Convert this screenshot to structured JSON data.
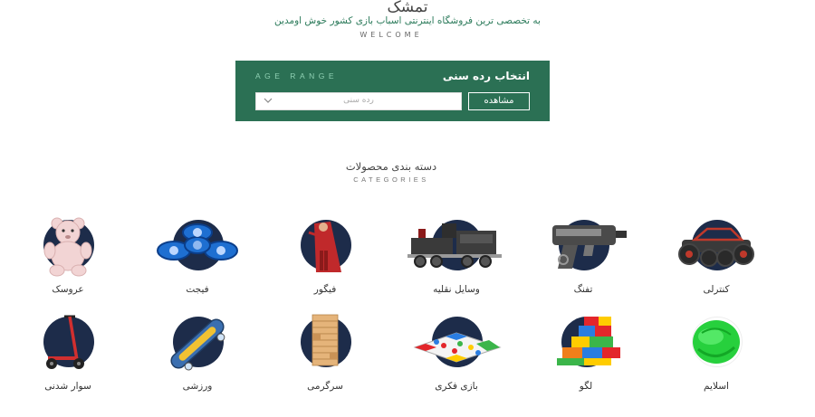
{
  "hero": {
    "brand": "تمشک",
    "tagline": "به تخصصی ترین فروشگاه اینترنتی اسباب بازی کشور خوش اومدین",
    "welcome": "WELCOME"
  },
  "age_range": {
    "title_en": "AGE RANGE",
    "title_fa": "انتخاب رده سنی",
    "select_placeholder": "رده سنی",
    "view_button": "مشاهده"
  },
  "categories": {
    "title_fa": "دسته بندی محصولات",
    "title_en": "CATEGORIES",
    "items": [
      {
        "label": "کنترلی",
        "icon": "rc-car-icon"
      },
      {
        "label": "تفنگ",
        "icon": "toy-gun-icon"
      },
      {
        "label": "وسایل نقلیه",
        "icon": "train-icon"
      },
      {
        "label": "فیگور",
        "icon": "figure-icon"
      },
      {
        "label": "فیجت",
        "icon": "fidget-spinner-icon"
      },
      {
        "label": "عروسک",
        "icon": "teddy-bear-icon"
      },
      {
        "label": "اسلایم",
        "icon": "slime-icon"
      },
      {
        "label": "لگو",
        "icon": "lego-icon"
      },
      {
        "label": "بازی فکری",
        "icon": "board-game-icon"
      },
      {
        "label": "سرگرمی",
        "icon": "jenga-icon"
      },
      {
        "label": "ورزشی",
        "icon": "skateboard-icon"
      },
      {
        "label": "سوار شدنی",
        "icon": "scooter-icon"
      }
    ]
  },
  "colors": {
    "accent_green": "#2b7054",
    "disc_navy": "#1d2c4a"
  }
}
